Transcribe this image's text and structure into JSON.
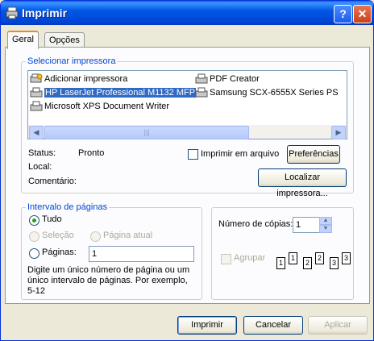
{
  "window": {
    "title": "Imprimir"
  },
  "tabs": [
    {
      "label": "Geral"
    },
    {
      "label": "Opções"
    }
  ],
  "printer_group": {
    "legend": "Selecionar impressora",
    "printers": [
      {
        "label": "Adicionar impressora",
        "icon": "add-printer-icon"
      },
      {
        "label": "PDF Creator",
        "icon": "printer-icon"
      },
      {
        "label": "HP LaserJet Professional M1132 MFP",
        "icon": "printer-icon",
        "selected": true
      },
      {
        "label": "Samsung SCX-6555X Series PS",
        "icon": "printer-icon"
      },
      {
        "label": "Microsoft XPS Document Writer",
        "icon": "printer-icon"
      }
    ],
    "status_label": "Status:",
    "status_value": "Pronto",
    "location_label": "Local:",
    "comment_label": "Comentário:",
    "print_to_file_label": "Imprimir em arquivo",
    "preferences_button": "Preferências",
    "find_printer_button": "Localizar impressora..."
  },
  "page_range": {
    "legend": "Intervalo de páginas",
    "all_label": "Tudo",
    "selection_label": "Seleção",
    "current_page_label": "Página atual",
    "pages_label": "Páginas:",
    "pages_value": "1",
    "help_text_1": "Digite um único número de página ou um",
    "help_text_2": "único intervalo de páginas. Por exemplo,",
    "help_text_3": "5-12"
  },
  "copies": {
    "label": "Número de cópias:",
    "value": "1",
    "collate_label": "Agrupar",
    "page_labels": [
      "1",
      "1",
      "2",
      "2",
      "3",
      "3"
    ]
  },
  "buttons": {
    "print": "Imprimir",
    "cancel": "Cancelar",
    "apply": "Aplicar"
  },
  "colors": {
    "accent": "#316ac5",
    "legend": "#0046d5",
    "titlebar": "#0058e6"
  }
}
